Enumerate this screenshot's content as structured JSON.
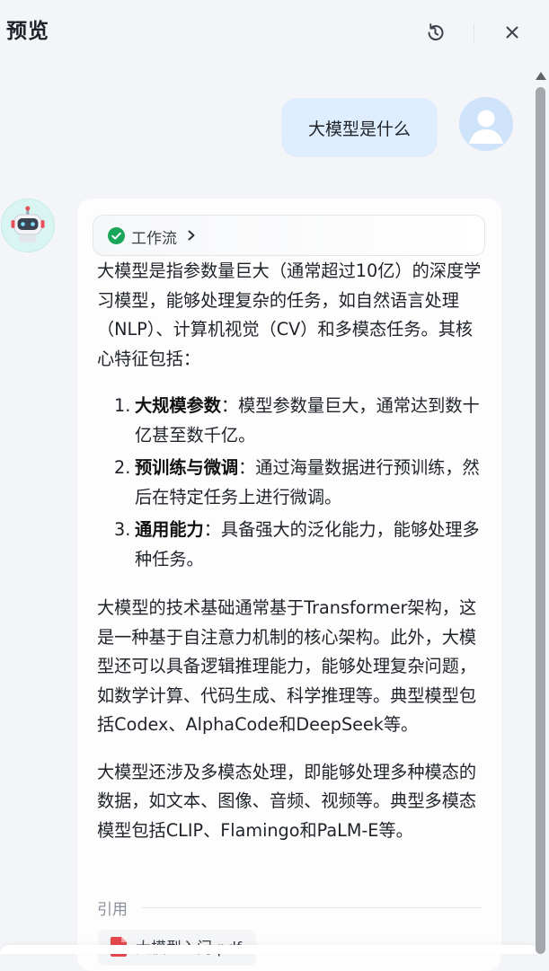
{
  "header": {
    "title": "预览",
    "refresh_icon": "refresh-icon",
    "close_icon": "close-icon"
  },
  "user_message": {
    "text": "大模型是什么"
  },
  "bot_message": {
    "workflow": {
      "label": "工作流",
      "status": "completed"
    },
    "intro": "大模型是指参数量巨大（通常超过10亿）的深度学习模型，能够处理复杂的任务，如自然语言处理（NLP）、计算机视觉（CV）和多模态任务。其核心特征包括：",
    "list": [
      {
        "num": "1.",
        "title": "大规模参数",
        "text": "：模型参数量巨大，通常达到数十亿甚至数千亿。"
      },
      {
        "num": "2.",
        "title": "预训练与微调",
        "text": "：通过海量数据进行预训练，然后在特定任务上进行微调。"
      },
      {
        "num": "3.",
        "title": "通用能力",
        "text": "：具备强大的泛化能力，能够处理多种任务。"
      }
    ],
    "para2": "大模型的技术基础通常基于Transformer架构，这是一种基于自注意力机制的核心架构。此外，大模型还可以具备逻辑推理能力，能够处理复杂问题，如数学计算、代码生成、科学推理等。典型模型包括Codex、AlphaCode和DeepSeek等。",
    "para3": "大模型还涉及多模态处理，即能够处理多种模态的数据，如文本、图像、音频、视频等。典型多模态模型包括CLIP、Flamingo和PaLM-E等。",
    "citation_label": "引用",
    "reference": {
      "name": "大模型入门.pdf",
      "icon": "pdf-file-icon"
    }
  },
  "colors": {
    "user_bubble": "#dfeeff",
    "check_green": "#19a55a",
    "pdf_red": "#e5484d",
    "background": "#f3f5f8"
  }
}
